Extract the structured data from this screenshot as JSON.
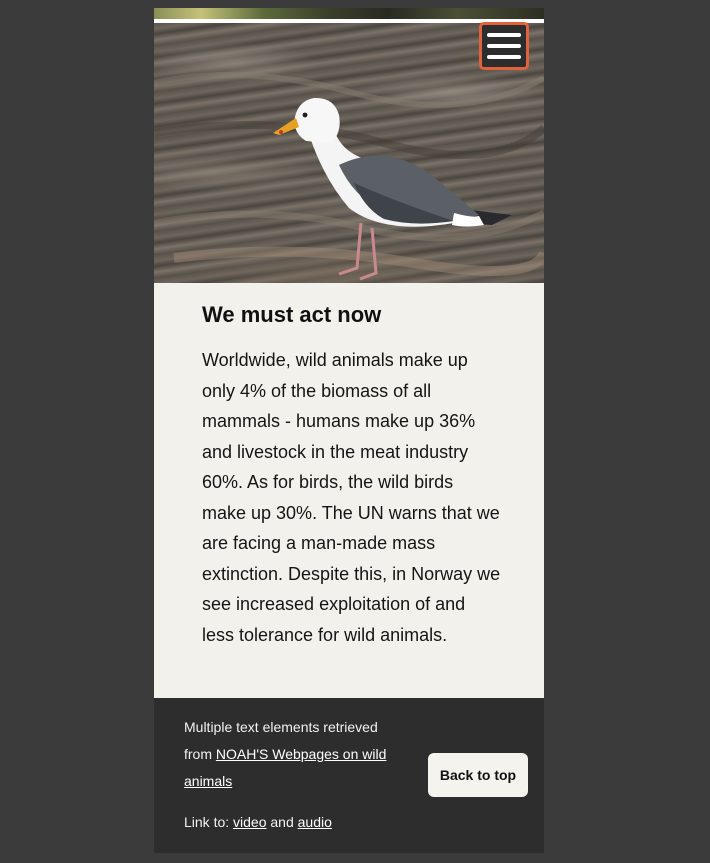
{
  "header": {
    "menu_label": "menu-icon"
  },
  "hero": {
    "image": "seagull on rocks"
  },
  "article": {
    "heading": "We must act now",
    "body": "Worldwide, wild animals make up only 4% of the biomass of all mammals - humans make up 36% and livestock in the meat industry 60%. As for birds, the wild birds make up 30%. The UN warns that we are facing a man-made mass extinction. Despite this, in Norway we see increased exploitation of and less tolerance for wild animals."
  },
  "footer": {
    "credit_prefix": "Multiple text elements retrieved from ",
    "credit_link": "NOAH'S Webpages on wild animals",
    "links_prefix": "Link to: ",
    "video_link": "video",
    "and_text": " and ",
    "audio_link": "audio",
    "back_to_top": "Back to top"
  },
  "colors": {
    "page_bg": "#3b3b3b",
    "card_bg": "#f3f1ec",
    "footer_bg": "#2d2d2d",
    "accent": "#e0623a"
  }
}
